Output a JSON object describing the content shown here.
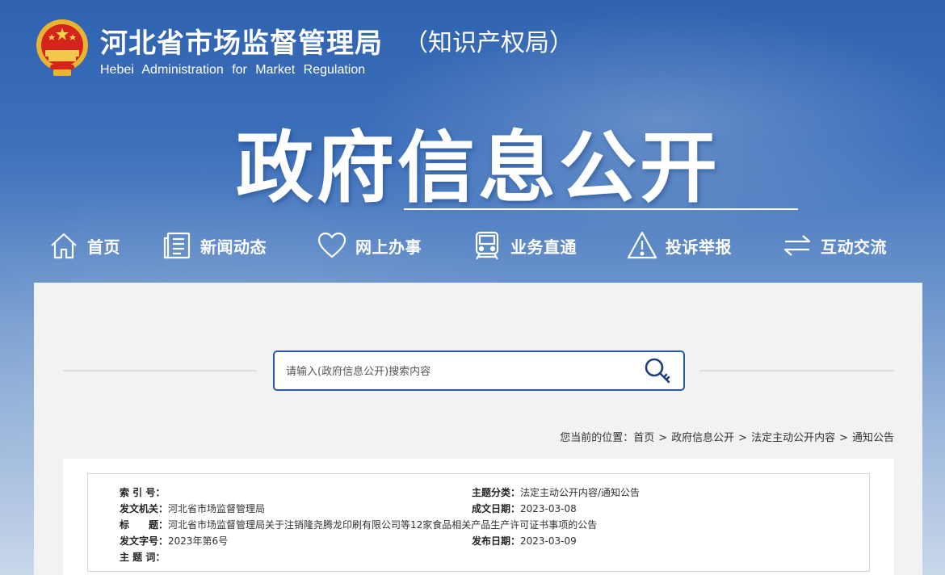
{
  "header": {
    "org_name": "河北省市场监督管理局",
    "org_sub": "（知识产权局）",
    "org_en": "Hebei Administration for Market Regulation",
    "hero_title": "政府信息公开"
  },
  "nav": [
    {
      "label": "首页",
      "icon": "home-icon"
    },
    {
      "label": "新闻动态",
      "icon": "news-icon"
    },
    {
      "label": "网上办事",
      "icon": "heart-icon"
    },
    {
      "label": "业务直通",
      "icon": "train-icon"
    },
    {
      "label": "投诉举报",
      "icon": "warning-icon"
    },
    {
      "label": "互动交流",
      "icon": "exchange-icon"
    }
  ],
  "search": {
    "placeholder": "请输入(政府信息公开)搜索内容"
  },
  "breadcrumb": {
    "prefix": "您当前的位置：",
    "items": [
      "首页",
      "政府信息公开",
      "法定主动公开内容",
      "通知公告"
    ],
    "sep": ">"
  },
  "info": {
    "index_label": "索 引 号：",
    "index_value": "",
    "category_label": "主题分类：",
    "category_value": "法定主动公开内容/通知公告",
    "issuer_label": "发文机关：",
    "issuer_value": "河北省市场监督管理局",
    "created_label": "成文日期：",
    "created_value": "2023-03-08",
    "title_label": "标　　题：",
    "title_value": "河北省市场监督管理局关于注销隆尧腾龙印刷有限公司等12家食品相关产品生产许可证书事项的公告",
    "docno_label": "发文字号：",
    "docno_value": "2023年第6号",
    "published_label": "发布日期：",
    "published_value": "2023-03-09",
    "keywords_label": "主 题 词：",
    "keywords_value": ""
  },
  "colors": {
    "banner_top": "#2f62b0",
    "accent": "#2a5aa0",
    "panel_bg": "#f2f2f2"
  }
}
